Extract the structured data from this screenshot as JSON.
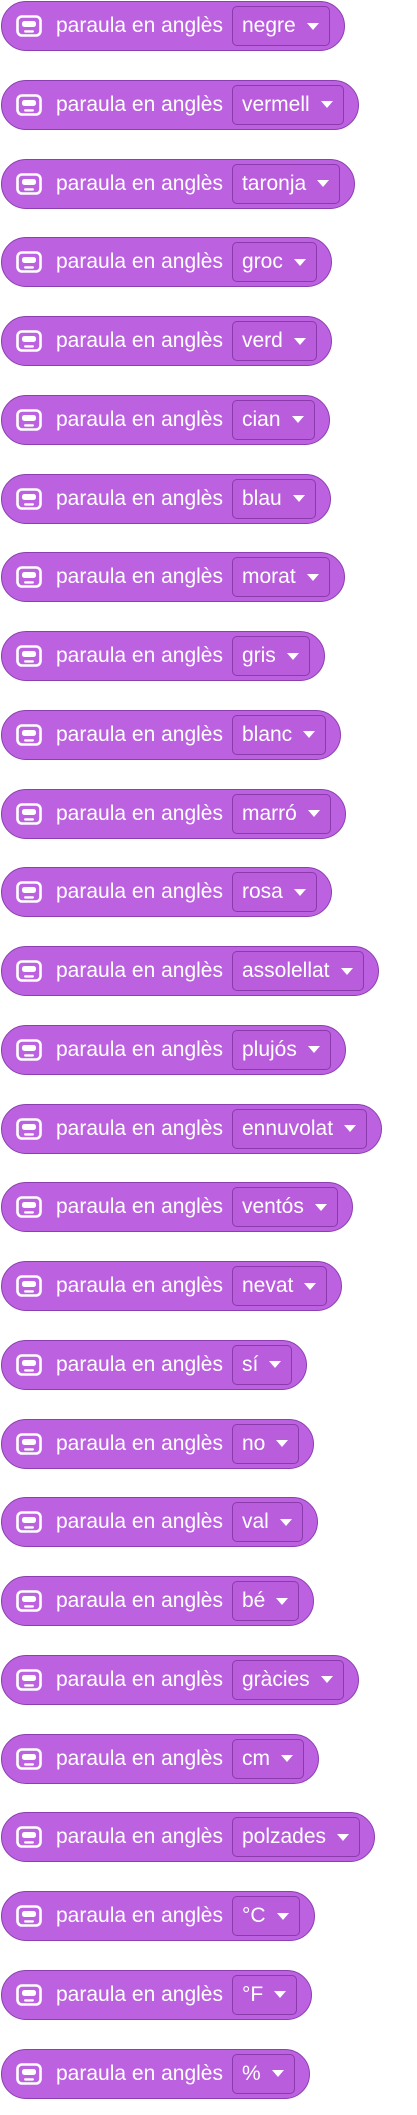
{
  "block_label": "paraula en anglès",
  "icon": "robot-face-icon",
  "colors": {
    "block_fill": "#bc62e1",
    "block_border": "#8c3fb0",
    "dropdown_fill": "#b95ddd",
    "dropdown_border": "#8a3aaa",
    "text": "#ffffff"
  },
  "blocks": [
    {
      "value": "negre"
    },
    {
      "value": "vermell"
    },
    {
      "value": "taronja"
    },
    {
      "value": "groc"
    },
    {
      "value": "verd"
    },
    {
      "value": "cian"
    },
    {
      "value": "blau"
    },
    {
      "value": "morat"
    },
    {
      "value": "gris"
    },
    {
      "value": "blanc"
    },
    {
      "value": "marró"
    },
    {
      "value": "rosa"
    },
    {
      "value": "assolellat"
    },
    {
      "value": "plujós"
    },
    {
      "value": "ennuvolat"
    },
    {
      "value": "ventós"
    },
    {
      "value": "nevat"
    },
    {
      "value": "sí"
    },
    {
      "value": "no"
    },
    {
      "value": "val"
    },
    {
      "value": "bé"
    },
    {
      "value": "gràcies"
    },
    {
      "value": "cm"
    },
    {
      "value": "polzades"
    },
    {
      "value": "°C"
    },
    {
      "value": "°F"
    },
    {
      "value": "%"
    }
  ]
}
